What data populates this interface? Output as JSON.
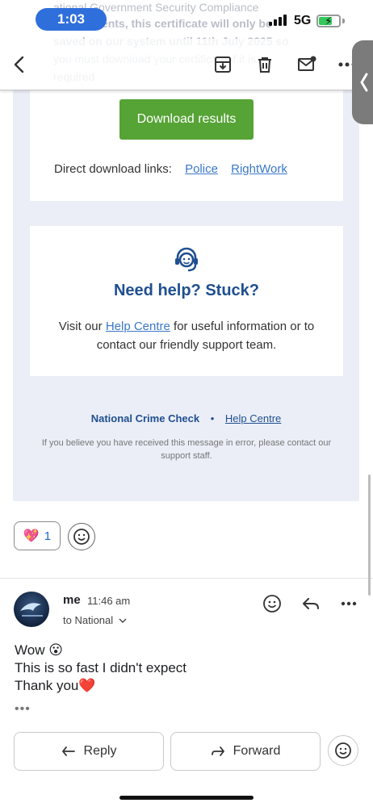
{
  "status_bar": {
    "time": "1:03",
    "network": "5G"
  },
  "email_bg_text": {
    "lines": [
      "ational Government Security Compliance",
      "requirements, this certificate will only be",
      "saved on our system until 11th July 2025 so",
      "you must download your certificate if it is",
      "required."
    ]
  },
  "email": {
    "download_button": "Download results",
    "direct_links_label": "Direct download links:",
    "link_police": "Police",
    "link_rightwork": "RightWork",
    "help_title": "Need help? Stuck?",
    "help_body_prefix": "Visit our ",
    "help_body_link": "Help Centre",
    "help_body_suffix": " for useful information or to contact our friendly support team.",
    "footer_brand": "National Crime Check",
    "footer_separator": "•",
    "footer_link": "Help Centre",
    "footer_note": "If you believe you have received this message in error, please contact our support staff."
  },
  "reactions": {
    "emoji": "💖",
    "count": "1"
  },
  "message": {
    "sender": "me",
    "time": "11:46 am",
    "recipient": "to National",
    "lines": [
      "Wow 😮",
      "This is so fast I didn't expect",
      "Thank you❤️"
    ],
    "collapsed": "•••"
  },
  "actions": {
    "reply": "Reply",
    "forward": "Forward"
  },
  "icons": {
    "back": "chevron-left-icon",
    "archive": "archive-icon",
    "delete": "trash-icon",
    "mark_unread": "mail-unread-icon",
    "more": "more-horizontal-icon",
    "help": "headset-icon",
    "add_reaction": "emoji-add-icon",
    "reply": "reply-icon",
    "forward": "forward-icon"
  },
  "colors": {
    "accent": "#56a336",
    "link": "#3a78c8",
    "brand": "#1f4f8f",
    "time_pill": "#2f6fdb"
  }
}
